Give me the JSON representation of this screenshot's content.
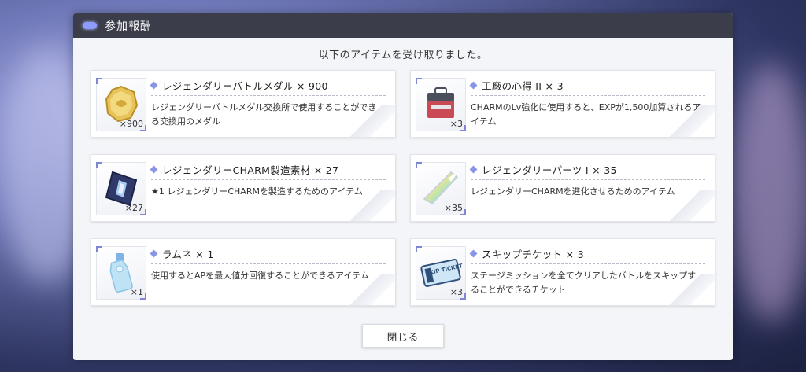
{
  "header": {
    "title": "参加報酬"
  },
  "subtitle": "以下のアイテムを受け取りました。",
  "items": [
    {
      "name": "レジェンダリーバトルメダル × 900",
      "qty": "×900",
      "desc": "レジェンダリーバトルメダル交換所で使用することができる交換用のメダル",
      "icon": "gold-medal-icon"
    },
    {
      "name": "工廠の心得 II × 3",
      "qty": "×3",
      "desc": "CHARMのLv強化に使用すると、EXPが1,500加算されるアイテム",
      "icon": "toolbox-icon"
    },
    {
      "name": "レジェンダリーCHARM製造素材 × 27",
      "qty": "×27",
      "desc": "★1 レジェンダリーCHARMを製造するためのアイテム",
      "icon": "crystal-case-icon"
    },
    {
      "name": "レジェンダリーパーツ I × 35",
      "qty": "×35",
      "desc": "レジェンダリーCHARMを進化させるためのアイテム",
      "icon": "blade-part-icon"
    },
    {
      "name": "ラムネ × 1",
      "qty": "×1",
      "desc": "使用するとAPを最大値分回復することができるアイテム",
      "icon": "ramune-bottle-icon"
    },
    {
      "name": "スキップチケット × 3",
      "qty": "×3",
      "desc": "ステージミッションを全てクリアしたバトルをスキップすることができるチケット",
      "icon": "skip-ticket-icon",
      "icon_text": "SKIP TICKET"
    }
  ],
  "close_label": "閉じる",
  "colors": {
    "accent": "#8b95e8",
    "header_bg": "#3b3d4a",
    "panel_bg": "#f4f5f8"
  }
}
